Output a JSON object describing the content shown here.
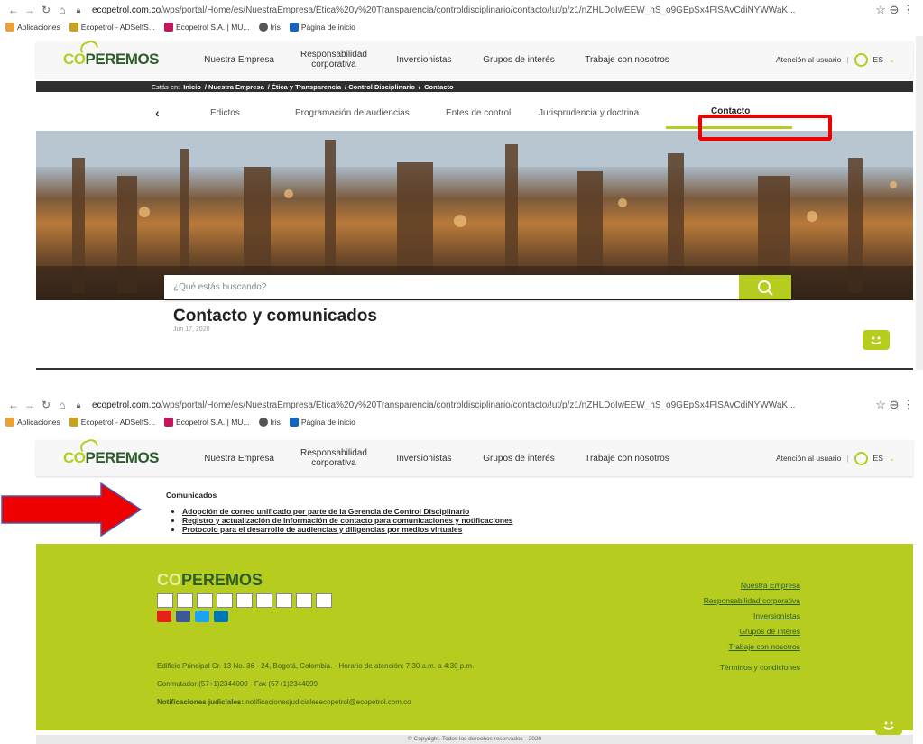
{
  "browser": {
    "url_host": "ecopetrol.com.co",
    "url_path": "/wps/portal/Home/es/NuestraEmpresa/Ética%20y%20Transparencia/controldisciplinario/contacto/!ut/p/z1/nZHLDoIwEEW_hS_o9GEpSx4FISAvCdiNYWWaK...",
    "bookmarks": [
      {
        "label": "Aplicaciones",
        "icon": "apps-grid-icon"
      },
      {
        "label": "Ecopetrol - ADSelfS...",
        "icon": "ecopetrol-icon"
      },
      {
        "label": "Ecopetrol S.A. | MU...",
        "icon": "mu-icon"
      },
      {
        "label": "Iris",
        "icon": "iris-icon"
      },
      {
        "label": "Página de inicio",
        "icon": "sf-icon"
      }
    ]
  },
  "site": {
    "logo": {
      "c": "CO",
      "rest": "PEREMOS"
    },
    "nav": [
      "Nuestra Empresa",
      "Responsabilidad corporativa",
      "Inversionistas",
      "Grupos de interés",
      "Trabaje con nosotros"
    ],
    "user_attention": "Atención al usuario",
    "lang": "ES",
    "breadcrumb_prefix": "Estás en:",
    "breadcrumb": [
      "Inicio",
      "/ Nuestra Empresa",
      "/ Ética y Transparencia",
      "/ Control Disciplinario",
      "/"
    ],
    "breadcrumb_current": "Contacto",
    "subnav": {
      "back": "‹",
      "items": [
        "Edictos",
        "Programación de audiencias",
        "Entes de control",
        "Jurisprudencia y doctrina"
      ],
      "active": "Contacto"
    },
    "search_placeholder": "¿Qué estás buscando?",
    "page_title": "Contacto y comunicados",
    "page_date": "Jun 17, 2020",
    "comms_heading": "Comunicados",
    "comms_links": [
      "Adopción de correo unificado por parte de la Gerencia de Control Disciplinario",
      "Registro y actualización de información de contacto para comunicaciones y notificaciones",
      "Protocolo para el desarrollo de audiencias y diligencias por medios virtuales"
    ],
    "footer": {
      "links": [
        "Nuestra Empresa",
        "Responsabilidad corporativa",
        "Inversionistas",
        "Grupos de interés",
        "Trabaje con nosotros"
      ],
      "terms": "Términos y condiciones",
      "address": "Edificio Principal Cr. 13 No. 36 - 24, Bogotá, Colombia. - Horario de atención: 7:30 a.m. a 4:30 p.m.",
      "phones": "Conmutador (57+1)2344000 - Fax (57+1)2344099",
      "notif_label": "Notificaciones judiciales:",
      "notif_email": "notificacionesjudicialesecopetrol@ecopetrol.com.co",
      "copyright": "© Copyright. Todos los derechos reservados - 2020"
    }
  },
  "colors": {
    "brand_green": "#b6cc1f",
    "dark_green": "#2b5d2b",
    "highlight_red": "#e00000"
  }
}
